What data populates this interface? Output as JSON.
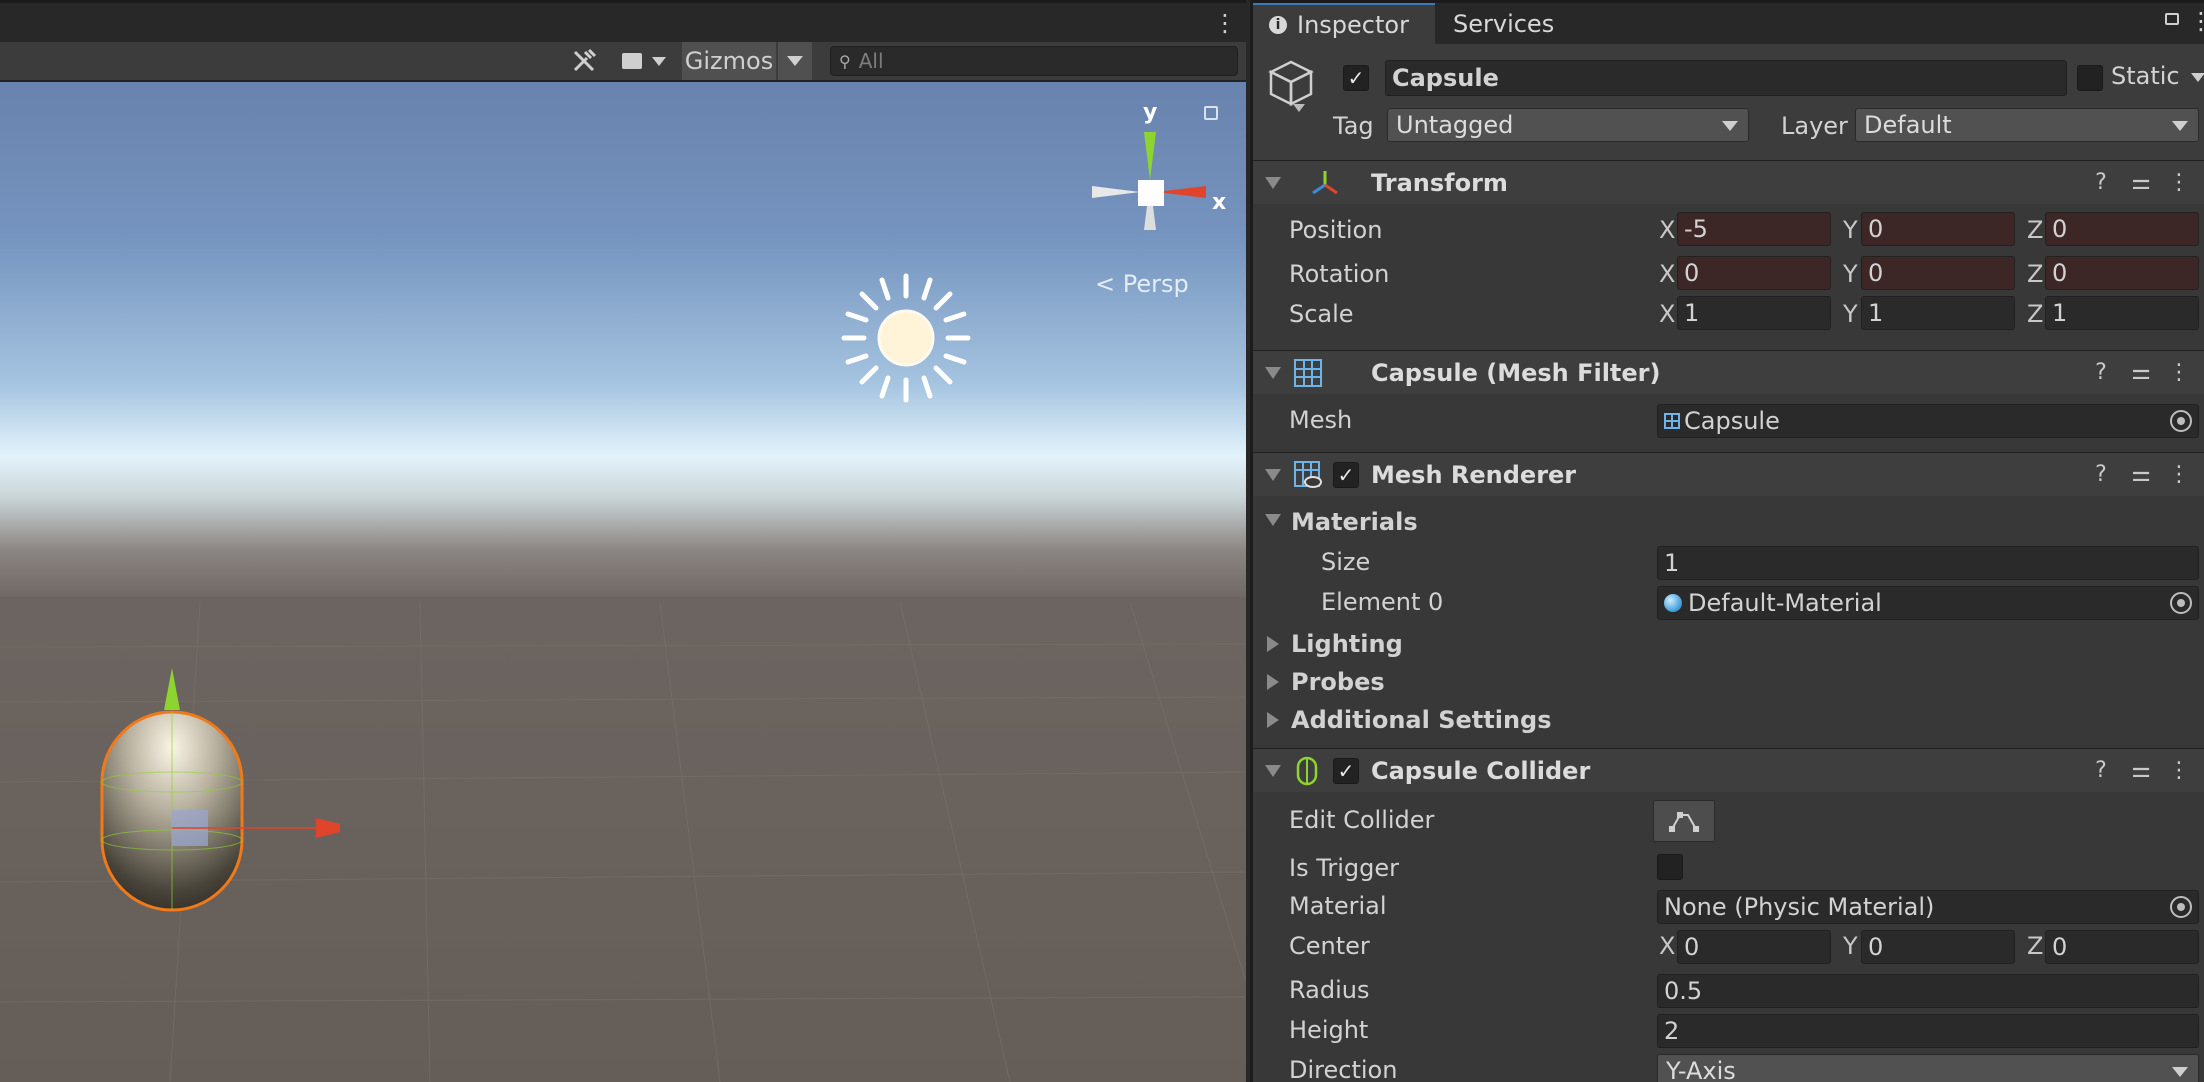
{
  "scene": {
    "toolbar": {
      "gizmos_label": "Gizmos",
      "search_placeholder": "All"
    },
    "orientation": {
      "y_label": "y",
      "x_label": "x",
      "persp_label": "Persp"
    }
  },
  "inspector": {
    "tabs": [
      {
        "label": "Inspector"
      },
      {
        "label": "Services"
      }
    ],
    "object": {
      "name": "Capsule",
      "static_label": "Static",
      "tag_label": "Tag",
      "tag_value": "Untagged",
      "layer_label": "Layer",
      "layer_value": "Default"
    },
    "transform": {
      "title": "Transform",
      "position": {
        "label": "Position",
        "x": "-5",
        "y": "0",
        "z": "0"
      },
      "rotation": {
        "label": "Rotation",
        "x": "0",
        "y": "0",
        "z": "0"
      },
      "scale": {
        "label": "Scale",
        "x": "1",
        "y": "1",
        "z": "1"
      },
      "axis_x": "X",
      "axis_y": "Y",
      "axis_z": "Z"
    },
    "mesh_filter": {
      "title": "Capsule (Mesh Filter)",
      "mesh_label": "Mesh",
      "mesh_value": "Capsule"
    },
    "mesh_renderer": {
      "title": "Mesh Renderer",
      "materials_label": "Materials",
      "size_label": "Size",
      "size_value": "1",
      "element0_label": "Element 0",
      "element0_value": "Default-Material",
      "lighting_label": "Lighting",
      "probes_label": "Probes",
      "additional_label": "Additional Settings"
    },
    "capsule_collider": {
      "title": "Capsule Collider",
      "edit_collider_label": "Edit Collider",
      "is_trigger_label": "Is Trigger",
      "material_label": "Material",
      "material_value": "None (Physic Material)",
      "center_label": "Center",
      "center": {
        "x": "0",
        "y": "0",
        "z": "0"
      },
      "radius_label": "Radius",
      "radius_value": "0.5",
      "height_label": "Height",
      "height_value": "2",
      "direction_label": "Direction",
      "direction_value": "Y-Axis"
    }
  },
  "colors": {
    "accent": "#3a79bb",
    "selection_outline": "#f07a1a",
    "gizmo_x": "#e0452b",
    "gizmo_y": "#8ed430"
  }
}
